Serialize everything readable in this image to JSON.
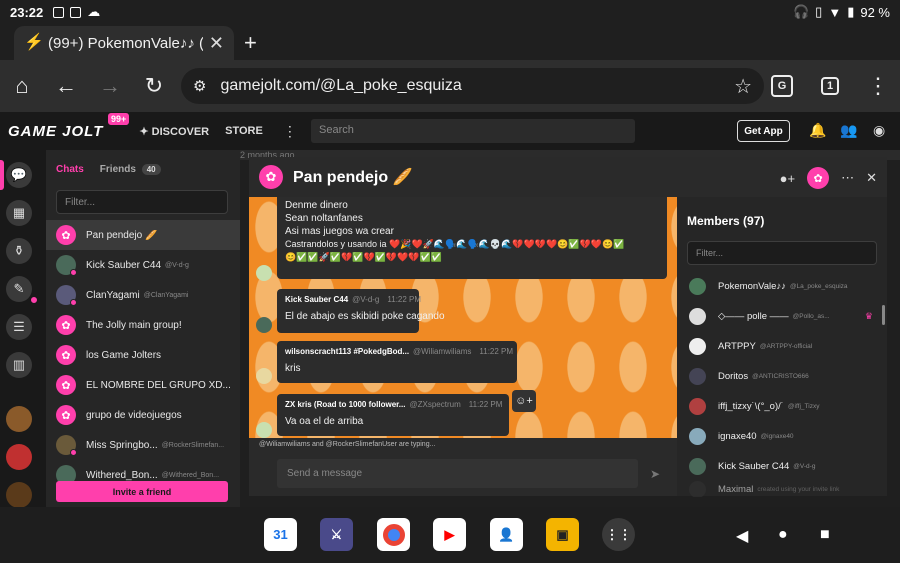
{
  "status_bar": {
    "time": "23:22",
    "battery": "92 %"
  },
  "browser": {
    "tab_title": "(99+) PokemonVale♪♪ (@La_poke_esquiza",
    "url": "gamejolt.com/@La_poke_esquiza",
    "tab_count": "1"
  },
  "gj_nav": {
    "logo": "GAME JOLT",
    "badge": "99+",
    "discover": "DISCOVER",
    "store": "STORE",
    "search_placeholder": "Search",
    "get_app": "Get App"
  },
  "sidebar": {
    "tab_chats": "Chats",
    "tab_friends": "Friends",
    "friends_count": "40",
    "filter_placeholder": "Filter...",
    "invite": "Invite a friend",
    "chats": [
      {
        "name": "Pan pendejo 🥖",
        "handle": ""
      },
      {
        "name": "Kick Sauber C44",
        "handle": "@V-d-g"
      },
      {
        "name": "ClanYagami",
        "handle": "@ClanYagami"
      },
      {
        "name": "The Jolly main group!",
        "handle": ""
      },
      {
        "name": "los Game Jolters",
        "handle": ""
      },
      {
        "name": "EL NOMBRE DEL GRUPO XD...",
        "handle": ""
      },
      {
        "name": "grupo de videojuegos",
        "handle": ""
      },
      {
        "name": "Miss Springbo...",
        "handle": "@RockerSlimefan..."
      },
      {
        "name": "Withered_Bon...",
        "handle": "@Withered_Bon..."
      }
    ]
  },
  "background_page": {
    "text": "2 months ago"
  },
  "chat": {
    "title": "Pan pendejo 🥖",
    "first_message_lines": [
      "Denme dinero",
      "Sean noltanfanes",
      "Asi mas juegos wa crear",
      "Castrandolos y usando ia ❤️🎉❤️🚀🌊🗣️🌊🗣️🌊💀🌊💔❤️💔❤️😊✅💔❤️😊✅",
      "😊✅✅🚀✅💔✅💔✅💔❤️💔✅✅"
    ],
    "messages": [
      {
        "author": "Kick Sauber C44",
        "handle": "@V-d-g",
        "time": "11:22 PM",
        "text": "El de abajo es skibidi poke cagando"
      },
      {
        "author": "wilsonscracht113 #PokedgBod...",
        "handle": "@Wiliamwiliams",
        "time": "11:22 PM",
        "text": "kris"
      },
      {
        "author": "ZX kris (Road to 1000 follower...",
        "handle": "@ZXspectrum",
        "time": "11:22 PM",
        "text": "Va oa el de arriba"
      }
    ],
    "typing": "@Wiliamwiliams and @RockerSlimefanUser are typing...",
    "input_placeholder": "Send a message"
  },
  "members": {
    "title": "Members (97)",
    "filter_placeholder": "Filter...",
    "list": [
      {
        "name": "PokemonVale♪♪",
        "handle": "@La_poke_esquiza"
      },
      {
        "name": "◇—— polle ——",
        "handle": "@Pollo_as..."
      },
      {
        "name": "ARTPPY",
        "handle": "@ARTPPY-official"
      },
      {
        "name": "Doritos",
        "handle": "@ANTICRISTO666"
      },
      {
        "name": "iffj_tizxy˙\\(°_o)/˙",
        "handle": "@iffj_Tizxy"
      },
      {
        "name": "ignaxe40",
        "handle": "@ignaxe40"
      },
      {
        "name": "Kick Sauber C44",
        "handle": "@V-d-g"
      },
      {
        "name": "Maximal",
        "handle": "created using your invite link"
      }
    ]
  },
  "dock": {
    "calendar_day": "31"
  }
}
